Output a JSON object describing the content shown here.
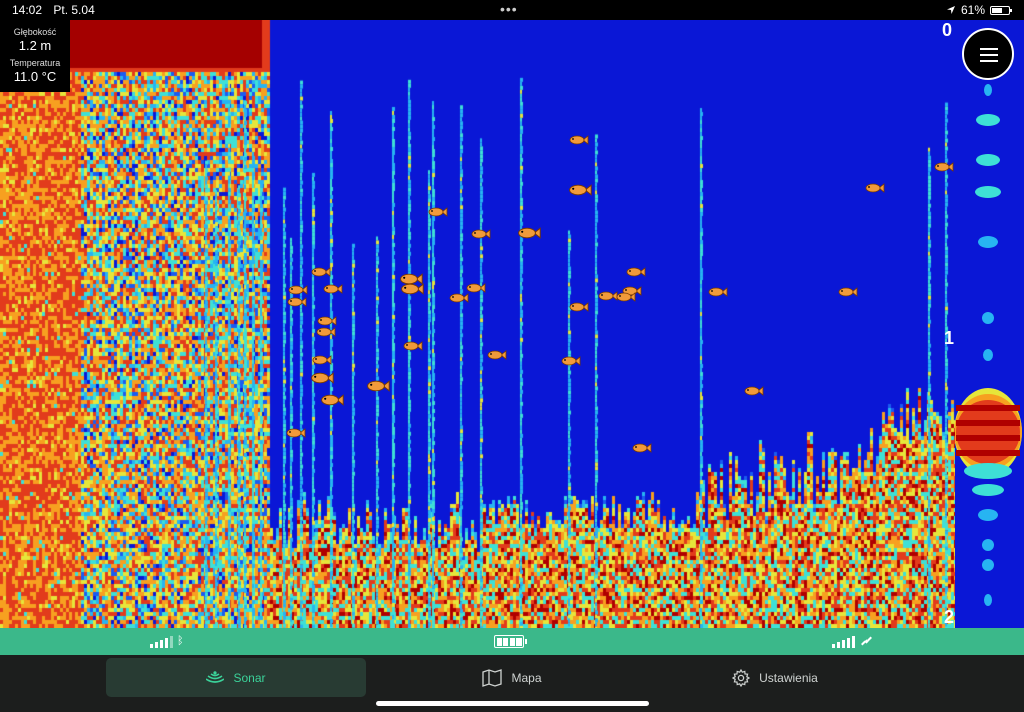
{
  "status_bar": {
    "time": "14:02",
    "date": "Pt. 5.04",
    "battery_percent": "61%",
    "battery_level": 0.61,
    "icons": [
      "location-arrow-icon",
      "battery-icon"
    ]
  },
  "readout": {
    "depth_label": "Głębokość",
    "depth_value": "1.2 m",
    "temperature_label": "Temperatura",
    "temperature_value": "11.0 °C"
  },
  "depth_scale": {
    "top": "0",
    "middle": "1",
    "bottom": "2"
  },
  "menu": {
    "icon": "hamburger-menu-icon"
  },
  "sonar": {
    "palette": [
      "#0a17d6",
      "#1b5cf0",
      "#27b4f2",
      "#3ee0d6",
      "#e6e63a",
      "#f7a020",
      "#e23b1c",
      "#b00000"
    ],
    "fish_color": "#f19a3a",
    "fish_count": 42
  },
  "signal_strip": {
    "left_signal_bars": 5,
    "left_icon": "bluetooth-icon",
    "battery_level": 1.0,
    "right_signal_bars": 5,
    "right_icon": "satellite-icon"
  },
  "tabs": [
    {
      "label": "Sonar",
      "icon": "sonar-icon",
      "active": true
    },
    {
      "label": "Mapa",
      "icon": "map-icon",
      "active": false
    },
    {
      "label": "Ustawienia",
      "icon": "gear-icon",
      "active": false
    }
  ]
}
